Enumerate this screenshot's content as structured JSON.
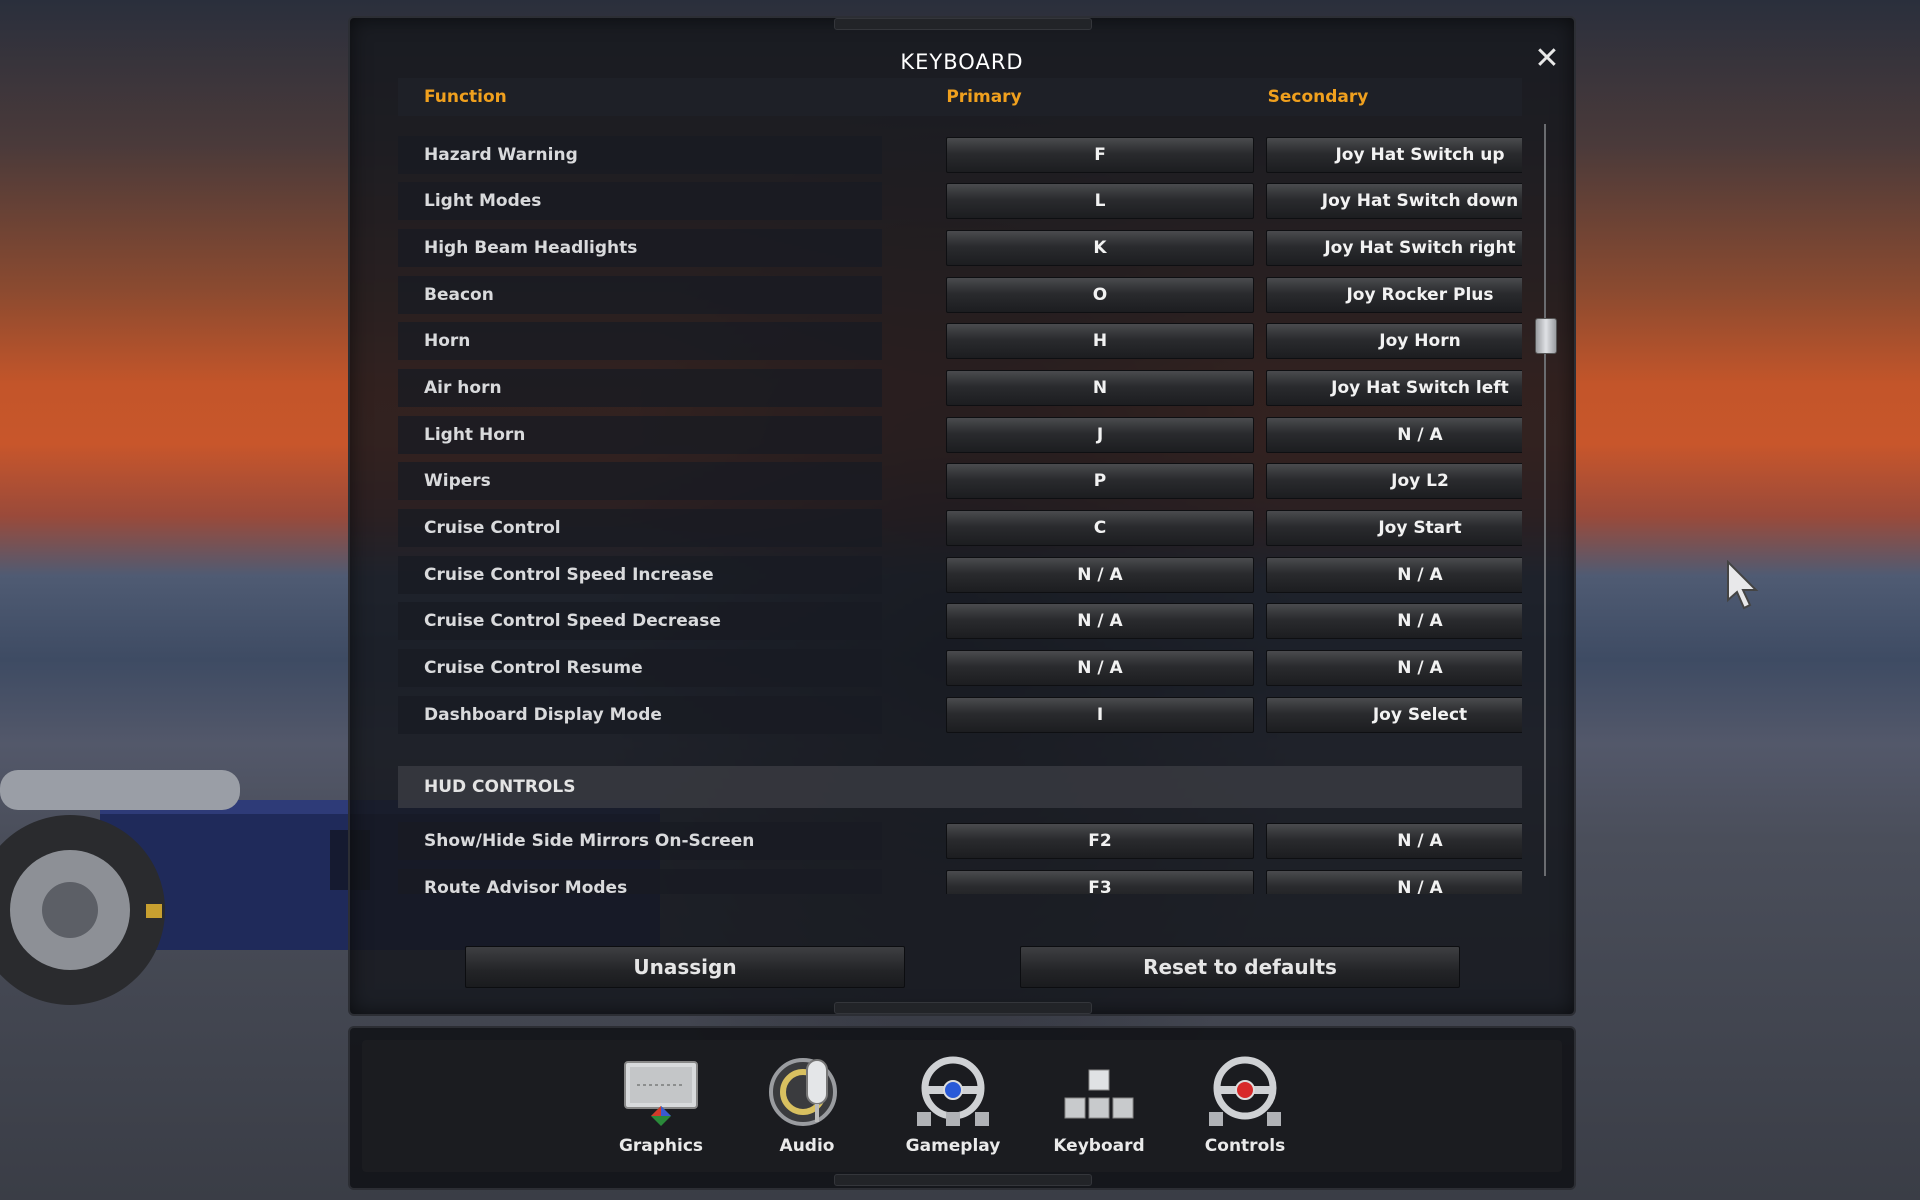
{
  "dialog": {
    "title": "KEYBOARD",
    "close_symbol": "✕"
  },
  "table": {
    "headers": {
      "function": "Function",
      "primary": "Primary",
      "secondary": "Secondary"
    },
    "rows": [
      {
        "function": "Hazard Warning",
        "primary": "F",
        "secondary": "Joy Hat Switch up"
      },
      {
        "function": "Light Modes",
        "primary": "L",
        "secondary": "Joy Hat Switch down"
      },
      {
        "function": "High Beam Headlights",
        "primary": "K",
        "secondary": "Joy Hat Switch right"
      },
      {
        "function": "Beacon",
        "primary": "O",
        "secondary": "Joy Rocker Plus"
      },
      {
        "function": "Horn",
        "primary": "H",
        "secondary": "Joy Horn"
      },
      {
        "function": "Air horn",
        "primary": "N",
        "secondary": "Joy Hat Switch left"
      },
      {
        "function": "Light Horn",
        "primary": "J",
        "secondary": "N / A"
      },
      {
        "function": "Wipers",
        "primary": "P",
        "secondary": "Joy L2"
      },
      {
        "function": "Cruise Control",
        "primary": "C",
        "secondary": "Joy Start"
      },
      {
        "function": "Cruise Control Speed Increase",
        "primary": "N / A",
        "secondary": "N / A"
      },
      {
        "function": "Cruise Control Speed Decrease",
        "primary": "N / A",
        "secondary": "N / A"
      },
      {
        "function": "Cruise Control Resume",
        "primary": "N / A",
        "secondary": "N / A"
      },
      {
        "function": "Dashboard Display Mode",
        "primary": "I",
        "secondary": "Joy Select"
      }
    ],
    "section": "HUD CONTROLS",
    "hud_rows": [
      {
        "function": "Show/Hide Side Mirrors On-Screen",
        "primary": "F2",
        "secondary": "N / A"
      },
      {
        "function": "Route Advisor Modes",
        "primary": "F3",
        "secondary": "N / A"
      }
    ]
  },
  "actions": {
    "unassign": "Unassign",
    "reset": "Reset to defaults"
  },
  "nav": {
    "items": [
      {
        "label": "Graphics",
        "icon": "monitor-icon"
      },
      {
        "label": "Audio",
        "icon": "microphone-icon"
      },
      {
        "label": "Gameplay",
        "icon": "steering-wheel-blue-icon"
      },
      {
        "label": "Keyboard",
        "icon": "keys-icon"
      },
      {
        "label": "Controls",
        "icon": "steering-wheel-red-icon"
      }
    ],
    "active": "Keyboard"
  },
  "colors": {
    "header_accent": "#f0a01e",
    "text": "#d9dadc"
  }
}
